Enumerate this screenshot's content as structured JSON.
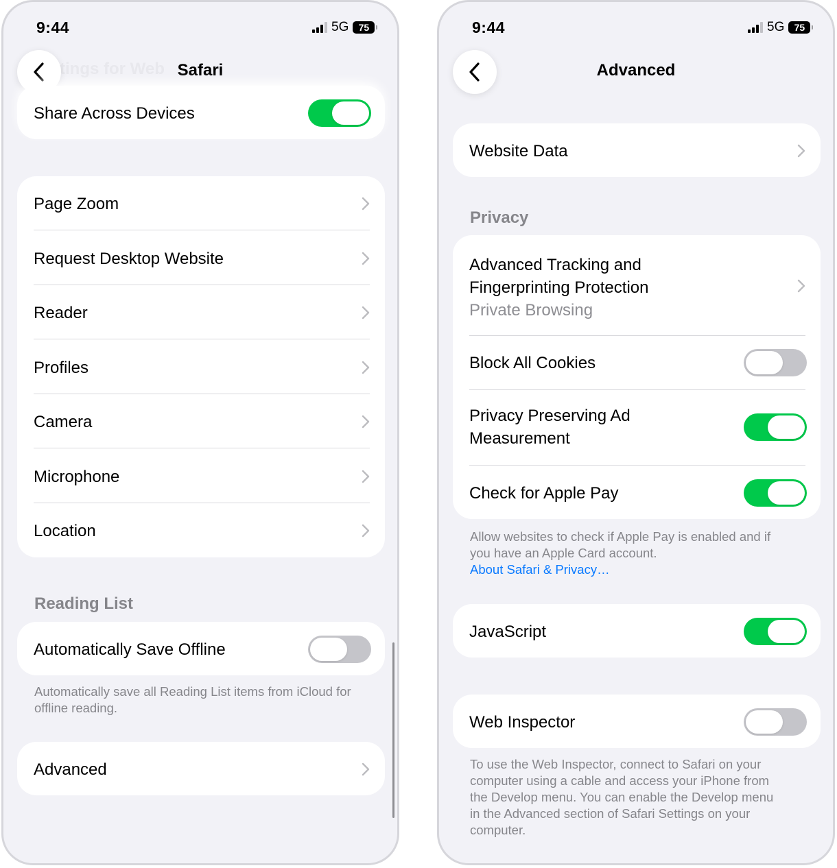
{
  "left_screen": {
    "status": {
      "time": "9:44",
      "network": "5G",
      "battery": "75"
    },
    "nav": {
      "title": "Safari",
      "ghost_title": "ttings for Web"
    },
    "share_row": {
      "label": "Share Across Devices",
      "toggle": "on"
    },
    "website_settings": [
      {
        "label": "Page Zoom"
      },
      {
        "label": "Request Desktop Website"
      },
      {
        "label": "Reader"
      },
      {
        "label": "Profiles"
      },
      {
        "label": "Camera"
      },
      {
        "label": "Microphone"
      },
      {
        "label": "Location"
      }
    ],
    "reading_list": {
      "header": "Reading List",
      "auto_save_label": "Automatically Save Offline",
      "auto_save_toggle": "off",
      "footer": "Automatically save all Reading List items from iCloud for offline reading."
    },
    "advanced_row": {
      "label": "Advanced"
    }
  },
  "right_screen": {
    "status": {
      "time": "9:44",
      "network": "5G",
      "battery": "75"
    },
    "nav": {
      "title": "Advanced"
    },
    "website_data": {
      "label": "Website Data"
    },
    "privacy": {
      "header": "Privacy",
      "tracking": {
        "label_line1": "Advanced Tracking and",
        "label_line2": "Fingerprinting Protection",
        "value": "Private Browsing"
      },
      "block_cookies": {
        "label": "Block All Cookies",
        "toggle": "off"
      },
      "ad_measurement": {
        "label_line1": "Privacy Preserving Ad",
        "label_line2": "Measurement",
        "toggle": "on"
      },
      "apple_pay": {
        "label": "Check for Apple Pay",
        "toggle": "on"
      },
      "footer_line1": "Allow websites to check if Apple Pay is enabled and if",
      "footer_line2": "you have an Apple Card account.",
      "footer_link": "About Safari & Privacy…"
    },
    "javascript": {
      "label": "JavaScript",
      "toggle": "on"
    },
    "web_inspector": {
      "label": "Web Inspector",
      "toggle": "off",
      "footer": [
        "To use the Web Inspector, connect to Safari on your",
        "computer using a cable and access your iPhone from",
        "the Develop menu. You can enable the Develop menu",
        "in the Advanced section of Safari Settings on your",
        "computer."
      ]
    }
  },
  "colors": {
    "toggle_on": "#00c94b",
    "toggle_off": "#c5c5ca",
    "link": "#0a7aff",
    "background": "#f2f2f7"
  }
}
